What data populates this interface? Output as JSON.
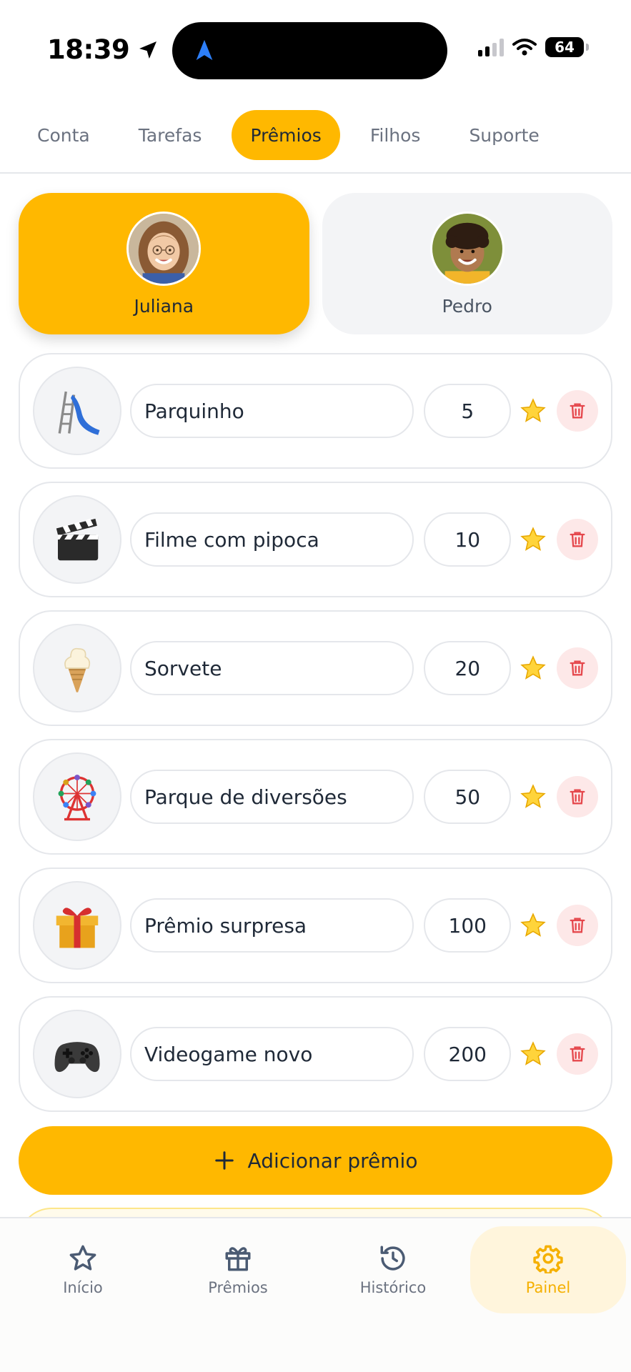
{
  "status_bar": {
    "time": "18:39",
    "battery": "64"
  },
  "tabs": [
    {
      "label": "Conta",
      "active": false
    },
    {
      "label": "Tarefas",
      "active": false
    },
    {
      "label": "Prêmios",
      "active": true
    },
    {
      "label": "Filhos",
      "active": false
    },
    {
      "label": "Suporte",
      "active": false
    }
  ],
  "children": [
    {
      "name": "Juliana",
      "active": true
    },
    {
      "name": "Pedro",
      "active": false
    }
  ],
  "rewards": [
    {
      "name": "Parquinho",
      "points": "5",
      "icon": "slide-icon"
    },
    {
      "name": "Filme com pipoca",
      "points": "10",
      "icon": "clapper-board-icon"
    },
    {
      "name": "Sorvete",
      "points": "20",
      "icon": "ice-cream-icon"
    },
    {
      "name": "Parque de diversões",
      "points": "50",
      "icon": "ferris-wheel-icon"
    },
    {
      "name": "Prêmio surpresa",
      "points": "100",
      "icon": "gift-icon"
    },
    {
      "name": "Videogame novo",
      "points": "200",
      "icon": "game-controller-icon"
    }
  ],
  "add_button": {
    "label": "Adicionar prêmio"
  },
  "bottom_nav": [
    {
      "label": "Início",
      "icon": "star-outline-icon",
      "active": false
    },
    {
      "label": "Prêmios",
      "icon": "gift-outline-icon",
      "active": false
    },
    {
      "label": "Histórico",
      "icon": "history-icon",
      "active": false
    },
    {
      "label": "Painel",
      "icon": "settings-gear-icon",
      "active": true
    }
  ],
  "colors": {
    "accent": "#FFB800",
    "delete_bg": "#fde8e8",
    "delete_icon": "#e5484d",
    "active_nav": "#F5B000"
  }
}
